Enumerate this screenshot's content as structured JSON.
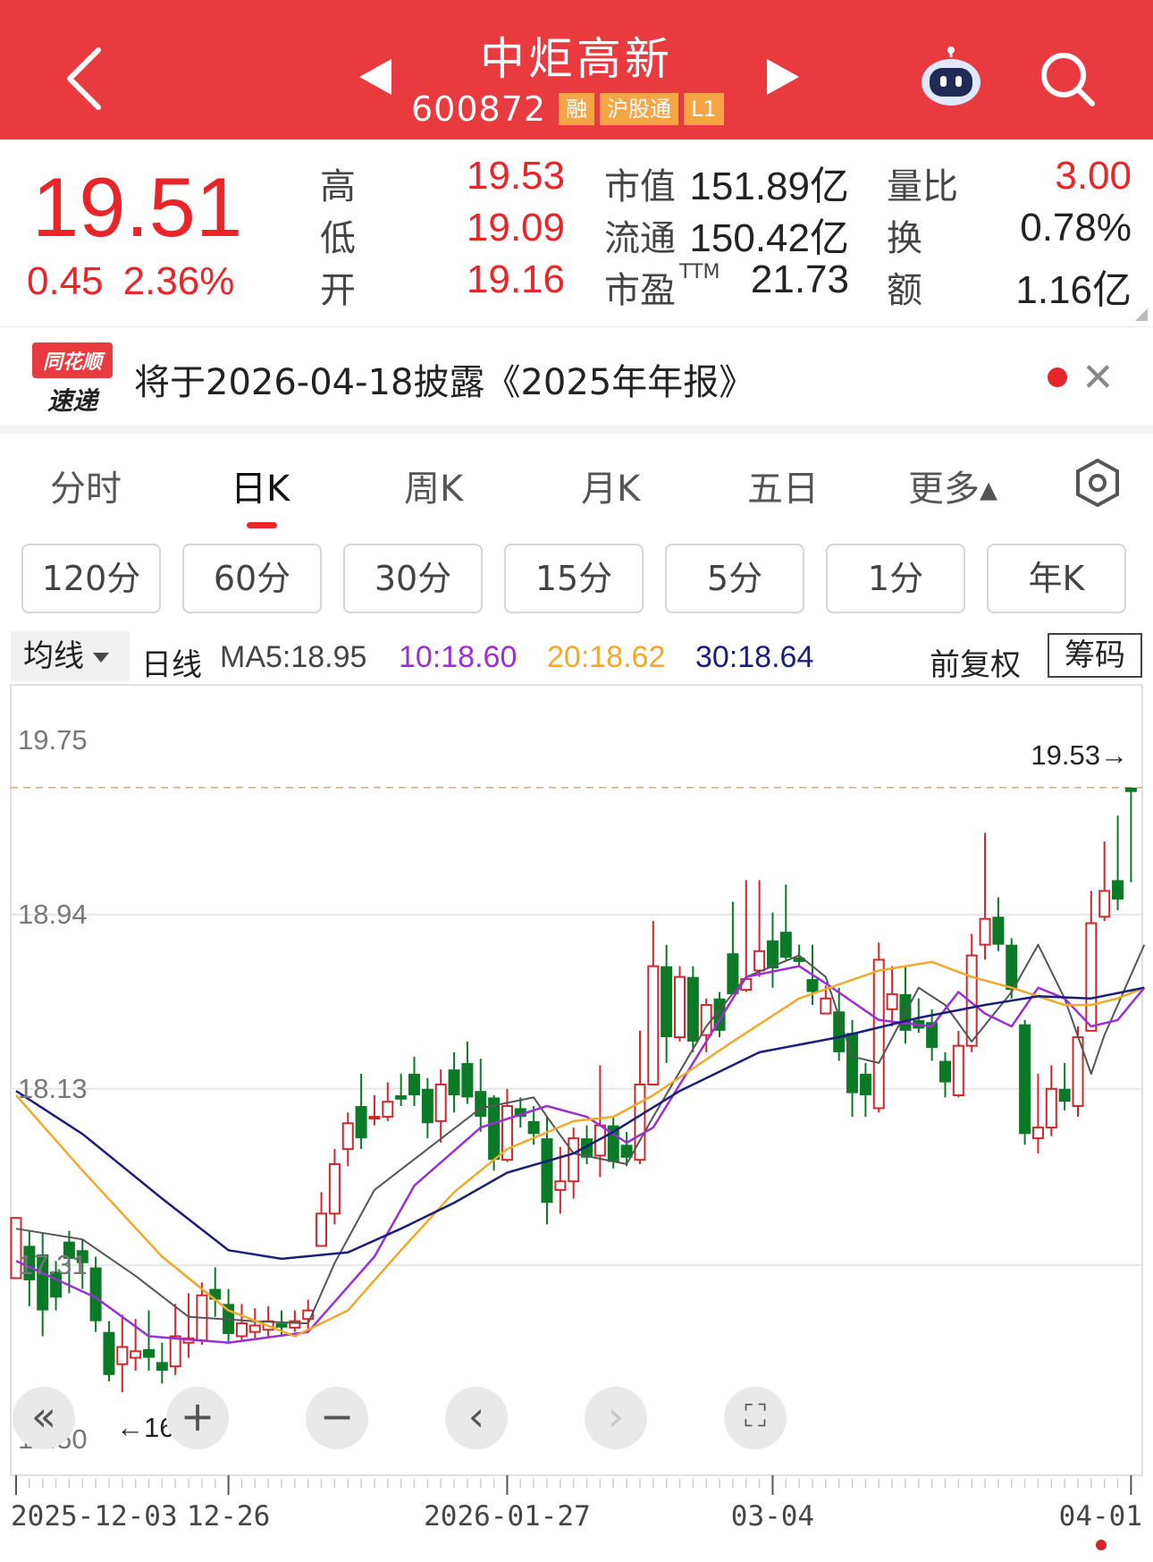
{
  "header": {
    "title": "中炬高新",
    "code": "600872",
    "tags": [
      "融",
      "沪股通",
      "L1"
    ]
  },
  "quote": {
    "price": "19.51",
    "change": "0.45",
    "change_pct": "2.36%",
    "rows": [
      {
        "label": "高",
        "value": "19.53",
        "label2": "市值",
        "value2": "151.89亿",
        "label3": "量比",
        "value3": "3.00"
      },
      {
        "label": "低",
        "value": "19.09",
        "label2": "流通",
        "value2": "150.42亿",
        "label3": "换",
        "value3": "0.78%"
      },
      {
        "label": "开",
        "value": "19.16",
        "label2": "市盈",
        "label2_sup": "TTM",
        "value2": "21.73",
        "label3": "额",
        "value3": "1.16亿"
      }
    ]
  },
  "news": {
    "logo_line1": "同花顺",
    "logo_line2": "速递",
    "text": "将于2026-04-18披露《2025年年报》"
  },
  "tabs": [
    "分时",
    "日K",
    "周K",
    "月K",
    "五日",
    "更多▴"
  ],
  "active_tab": "日K",
  "periods": [
    "120分",
    "60分",
    "30分",
    "15分",
    "5分",
    "1分",
    "年K"
  ],
  "ma_bar": {
    "dropdown": "均线",
    "line_type": "日线",
    "ma5": "MA5:18.95",
    "ma10": "10:18.60",
    "ma20": "20:18.62",
    "ma30": "30:18.64",
    "adjust": "前复权",
    "chip": "筹码"
  },
  "colors": {
    "header_bg": "#e83a3f",
    "up": "#d0272c",
    "down": "#0a7a26",
    "ma5": "#555555",
    "ma10": "#9b2fd4",
    "ma20": "#f0a92a",
    "ma30": "#1b1d7a"
  },
  "controls": [
    "double-left-icon",
    "zoom-in-icon",
    "zoom-out-icon",
    "left-icon",
    "right-icon",
    "fullscreen-icon"
  ],
  "chart_data": {
    "type": "candlestick",
    "y_ticks": [
      "19.75",
      "18.94",
      "18.13",
      "17.31",
      "16.50"
    ],
    "ylim": [
      16.5,
      19.75
    ],
    "x_labels": [
      "2025-12-03",
      "12-26",
      "2026-01-27",
      "03-04",
      "04-01"
    ],
    "high_label": "19.53→",
    "high_value": 19.53,
    "low_label": "←16.72",
    "low_value": 16.72,
    "candles": [
      [
        17.25,
        17.53,
        17.45,
        17.5
      ],
      [
        17.4,
        17.24,
        17.12,
        17.47
      ],
      [
        17.36,
        17.1,
        16.98,
        17.46
      ],
      [
        17.28,
        17.16,
        17.1,
        17.33
      ],
      [
        17.42,
        17.34,
        17.18,
        17.47
      ],
      [
        17.38,
        17.32,
        17.2,
        17.43
      ],
      [
        17.3,
        17.05,
        17.0,
        17.35
      ],
      [
        17.0,
        16.8,
        16.77,
        17.05
      ],
      [
        16.85,
        16.93,
        16.72,
        17.08
      ],
      [
        16.88,
        16.91,
        16.82,
        17.06
      ],
      [
        16.92,
        16.88,
        16.82,
        17.1
      ],
      [
        16.86,
        16.82,
        16.76,
        16.95
      ],
      [
        16.84,
        16.98,
        16.8,
        17.13
      ],
      [
        16.95,
        16.97,
        16.88,
        17.18
      ],
      [
        16.96,
        17.17,
        16.94,
        17.23
      ],
      [
        17.2,
        17.15,
        17.07,
        17.3
      ],
      [
        17.13,
        16.99,
        16.95,
        17.2
      ],
      [
        16.98,
        17.04,
        16.96,
        17.13
      ],
      [
        17.0,
        17.03,
        16.97,
        17.11
      ],
      [
        17.01,
        17.05,
        16.98,
        17.12
      ],
      [
        17.04,
        17.02,
        16.98,
        17.1
      ],
      [
        17.02,
        17.05,
        17.0,
        17.1
      ],
      [
        17.06,
        17.1,
        17.0,
        17.15
      ],
      [
        17.4,
        17.55,
        17.4,
        17.65
      ],
      [
        17.55,
        17.78,
        17.5,
        17.85
      ],
      [
        17.85,
        17.97,
        17.77,
        18.02
      ],
      [
        18.05,
        17.9,
        17.85,
        18.2
      ],
      [
        18.0,
        18.0,
        17.96,
        18.1
      ],
      [
        18.0,
        18.07,
        17.98,
        18.16
      ],
      [
        18.1,
        18.08,
        18.05,
        18.2
      ],
      [
        18.2,
        18.1,
        18.05,
        18.28
      ],
      [
        18.13,
        17.97,
        17.9,
        18.18
      ],
      [
        17.98,
        18.15,
        17.88,
        18.22
      ],
      [
        18.22,
        18.1,
        18.02,
        18.3
      ],
      [
        18.25,
        18.09,
        18.06,
        18.35
      ],
      [
        18.12,
        18.0,
        17.93,
        18.27
      ],
      [
        18.09,
        17.8,
        17.75,
        18.1
      ],
      [
        17.8,
        18.05,
        17.79,
        18.13
      ],
      [
        18.04,
        18.0,
        17.95,
        18.09
      ],
      [
        17.98,
        17.92,
        17.87,
        18.05
      ],
      [
        17.9,
        17.6,
        17.5,
        18.0
      ],
      [
        17.66,
        17.7,
        17.55,
        17.86
      ],
      [
        17.7,
        17.9,
        17.62,
        17.95
      ],
      [
        17.9,
        17.81,
        17.78,
        17.96
      ],
      [
        17.82,
        17.96,
        17.72,
        18.24
      ],
      [
        17.96,
        17.79,
        17.76,
        18.0
      ],
      [
        17.87,
        17.81,
        17.77,
        17.93
      ],
      [
        17.8,
        18.15,
        17.78,
        18.4
      ],
      [
        18.15,
        18.7,
        18.15,
        18.91
      ],
      [
        18.7,
        18.37,
        18.25,
        18.8
      ],
      [
        18.37,
        18.65,
        18.35,
        18.7
      ],
      [
        18.65,
        18.35,
        18.3,
        18.7
      ],
      [
        18.38,
        18.52,
        18.3,
        18.55
      ],
      [
        18.55,
        18.4,
        18.37,
        18.58
      ],
      [
        18.76,
        18.57,
        18.57,
        19.0
      ],
      [
        18.59,
        18.64,
        18.58,
        19.1
      ],
      [
        18.68,
        18.77,
        18.65,
        19.1
      ],
      [
        18.82,
        18.69,
        18.6,
        18.95
      ],
      [
        18.86,
        18.74,
        18.73,
        19.08
      ],
      [
        18.74,
        18.72,
        18.7,
        18.8
      ],
      [
        18.64,
        18.58,
        18.52,
        18.8
      ],
      [
        18.48,
        18.55,
        18.5,
        18.61
      ],
      [
        18.49,
        18.3,
        18.26,
        18.6
      ],
      [
        18.39,
        18.11,
        18.0,
        18.45
      ],
      [
        18.2,
        18.1,
        18.0,
        18.25
      ],
      [
        18.04,
        18.73,
        18.02,
        18.81
      ],
      [
        18.5,
        18.57,
        18.42,
        18.7
      ],
      [
        18.57,
        18.4,
        18.34,
        18.7
      ],
      [
        18.45,
        18.41,
        18.39,
        18.55
      ],
      [
        18.44,
        18.32,
        18.26,
        18.5
      ],
      [
        18.26,
        18.16,
        18.09,
        18.3
      ],
      [
        18.1,
        18.33,
        18.09,
        18.4
      ],
      [
        18.33,
        18.75,
        18.3,
        18.85
      ],
      [
        18.8,
        18.92,
        18.73,
        19.32
      ],
      [
        18.93,
        18.8,
        18.77,
        19.02
      ],
      [
        18.8,
        18.59,
        18.55,
        18.83
      ],
      [
        18.43,
        17.92,
        17.87,
        18.45
      ],
      [
        17.9,
        17.95,
        17.83,
        18.2
      ],
      [
        17.95,
        18.13,
        17.91,
        18.24
      ],
      [
        18.13,
        18.07,
        18.03,
        18.25
      ],
      [
        18.05,
        18.37,
        18.0,
        18.42
      ],
      [
        18.4,
        18.9,
        18.4,
        19.05
      ],
      [
        18.93,
        19.05,
        18.91,
        19.28
      ],
      [
        19.1,
        19.01,
        18.96,
        19.4
      ],
      [
        19.53,
        19.51,
        19.09,
        19.53
      ]
    ],
    "ma5": [
      [
        17.48,
        0
      ],
      [
        17.43,
        5
      ],
      [
        17.26,
        9
      ],
      [
        17.07,
        13
      ],
      [
        17.05,
        18
      ],
      [
        17.04,
        22
      ],
      [
        17.32,
        24
      ],
      [
        17.66,
        27
      ],
      [
        17.85,
        31
      ],
      [
        18.04,
        35
      ],
      [
        18.09,
        39
      ],
      [
        18.0,
        40
      ],
      [
        17.83,
        42
      ],
      [
        17.78,
        46
      ],
      [
        18.0,
        48
      ],
      [
        18.42,
        52
      ],
      [
        18.65,
        55
      ],
      [
        18.75,
        59
      ],
      [
        18.65,
        61
      ],
      [
        18.28,
        63
      ],
      [
        18.25,
        65
      ],
      [
        18.6,
        68
      ],
      [
        18.52,
        70
      ],
      [
        18.35,
        72
      ],
      [
        18.58,
        75
      ],
      [
        18.8,
        77
      ],
      [
        18.55,
        79
      ],
      [
        18.2,
        81
      ],
      [
        18.38,
        82
      ],
      [
        18.8,
        85
      ]
    ],
    "ma10": [
      [
        17.33,
        0
      ],
      [
        17.16,
        6
      ],
      [
        16.98,
        10
      ],
      [
        16.95,
        16
      ],
      [
        17.0,
        22
      ],
      [
        17.35,
        27
      ],
      [
        17.68,
        30
      ],
      [
        17.95,
        35
      ],
      [
        18.05,
        40
      ],
      [
        18.0,
        43
      ],
      [
        17.88,
        46
      ],
      [
        17.95,
        48
      ],
      [
        18.25,
        51
      ],
      [
        18.65,
        55
      ],
      [
        18.7,
        59
      ],
      [
        18.62,
        61
      ],
      [
        18.45,
        65
      ],
      [
        18.42,
        69
      ],
      [
        18.58,
        71
      ],
      [
        18.48,
        73
      ],
      [
        18.42,
        75
      ],
      [
        18.6,
        77
      ],
      [
        18.55,
        79
      ],
      [
        18.42,
        81
      ],
      [
        18.45,
        83
      ],
      [
        18.6,
        85
      ]
    ],
    "ma20": [
      [
        18.1,
        0
      ],
      [
        17.75,
        5
      ],
      [
        17.35,
        11
      ],
      [
        17.1,
        16
      ],
      [
        16.98,
        21
      ],
      [
        17.1,
        25
      ],
      [
        17.38,
        29
      ],
      [
        17.65,
        33
      ],
      [
        17.85,
        37
      ],
      [
        17.98,
        42
      ],
      [
        18.0,
        45
      ],
      [
        18.1,
        48
      ],
      [
        18.35,
        54
      ],
      [
        18.55,
        59
      ],
      [
        18.68,
        65
      ],
      [
        18.72,
        69
      ],
      [
        18.65,
        72
      ],
      [
        18.6,
        75
      ],
      [
        18.52,
        79
      ],
      [
        18.52,
        81
      ],
      [
        18.55,
        83
      ],
      [
        18.6,
        85
      ]
    ],
    "ma30": [
      [
        18.12,
        0
      ],
      [
        17.92,
        5
      ],
      [
        17.62,
        11
      ],
      [
        17.38,
        16
      ],
      [
        17.34,
        20
      ],
      [
        17.37,
        25
      ],
      [
        17.48,
        29
      ],
      [
        17.6,
        33
      ],
      [
        17.74,
        37
      ],
      [
        17.83,
        42
      ],
      [
        17.93,
        45
      ],
      [
        18.12,
        50
      ],
      [
        18.3,
        56
      ],
      [
        18.37,
        62
      ],
      [
        18.46,
        68
      ],
      [
        18.52,
        73
      ],
      [
        18.56,
        77
      ],
      [
        18.55,
        81
      ],
      [
        18.6,
        85
      ]
    ]
  }
}
